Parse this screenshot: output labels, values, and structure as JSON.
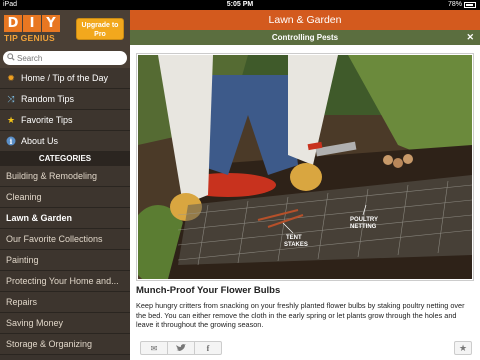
{
  "status": {
    "carrier": "iPad",
    "time": "5:05 PM",
    "battery": "78%"
  },
  "sidebar": {
    "logo_letters": [
      "D",
      "I",
      "Y"
    ],
    "logo_sub": "TIP GENIUS",
    "upgrade_label": "Upgrade to Pro",
    "search_placeholder": "Search",
    "nav": [
      {
        "label": "Home / Tip of the Day",
        "icon": "sun-icon"
      },
      {
        "label": "Random Tips",
        "icon": "shuffle-icon"
      },
      {
        "label": "Favorite Tips",
        "icon": "star-icon"
      },
      {
        "label": "About Us",
        "icon": "info-icon"
      }
    ],
    "categories_header": "CATEGORIES",
    "categories": [
      "Building & Remodeling",
      "Cleaning",
      "Lawn & Garden",
      "Our Favorite Collections",
      "Painting",
      "Protecting Your Home and...",
      "Repairs",
      "Saving Money",
      "Storage & Organizing"
    ],
    "active_category": "Lawn & Garden"
  },
  "main": {
    "title": "Lawn & Garden",
    "subtitle": "Controlling Pests",
    "close_glyph": "✕",
    "photo_labels": {
      "netting": "POULTRY NETTING",
      "stakes": "TENT STAKES"
    },
    "tip_title": "Munch-Proof Your Flower Bulbs",
    "tip_body": "Keep hungry critters from snacking on your freshly planted flower bulbs by staking poultry netting over the bed. You can either remove the cloth in the early spring or let plants grow through the holes and leave it throughout the growing season.",
    "share": [
      {
        "icon": "mail-icon",
        "glyph": "✉"
      },
      {
        "icon": "twitter-icon",
        "glyph": "🐦"
      },
      {
        "icon": "facebook-icon",
        "glyph": "f"
      }
    ],
    "favorite_glyph": "★"
  },
  "colors": {
    "accent_orange": "#d35a1e",
    "subtitle_green": "#5b6e3f",
    "sidebar_bg": "#3d352e",
    "upgrade_yellow": "#f2a81d"
  }
}
